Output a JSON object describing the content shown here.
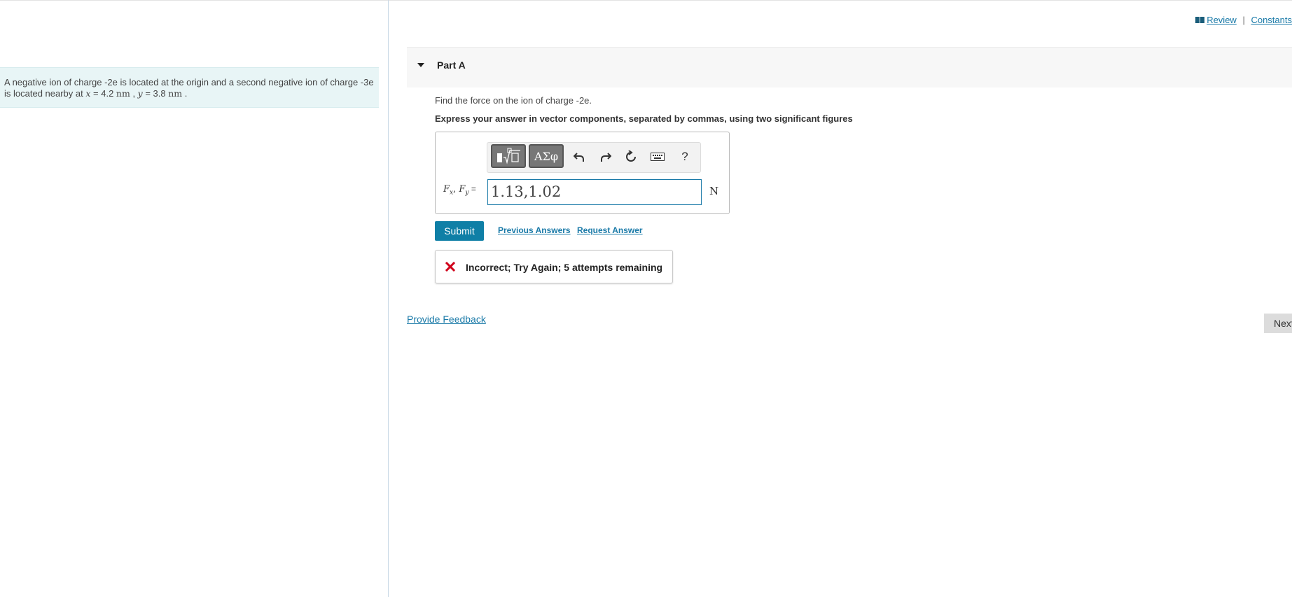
{
  "problem": {
    "text_part1": "A negative ion of charge -2e is located at the origin and a second negative ion of charge -3e is located nearby at ",
    "x_var": "x",
    "x_eq": " = 4.2 ",
    "x_unit": "nm",
    "sep": " , ",
    "y_var": "y",
    "y_eq": " = 3.8 ",
    "y_unit": "nm",
    "end": " ."
  },
  "header_links": {
    "review": "Review",
    "separator": "|",
    "constants": "Constants"
  },
  "part": {
    "title": "Part A",
    "question": "Find the force on the ion of charge -2e.",
    "instruction": "Express your answer in vector components, separated by commas, using two significant figures"
  },
  "toolbar": {
    "greek_label": "ΑΣφ",
    "help_label": "?"
  },
  "answer": {
    "label_fx": "F",
    "label_fx_sub": "x",
    "label_sep": ", ",
    "label_fy": "F",
    "label_fy_sub": "y",
    "label_eq": " =",
    "value": "1.13,1.02",
    "unit": "N"
  },
  "actions": {
    "submit": "Submit",
    "previous_answers": "Previous Answers",
    "request_answer": "Request Answer"
  },
  "feedback": {
    "message": "Incorrect; Try Again; 5 attempts remaining"
  },
  "footer": {
    "provide_feedback": "Provide Feedback",
    "next": "Next"
  },
  "colors": {
    "accent": "#0f7fa6",
    "error": "#d0021b",
    "problem_bg": "#e8f5f6"
  }
}
